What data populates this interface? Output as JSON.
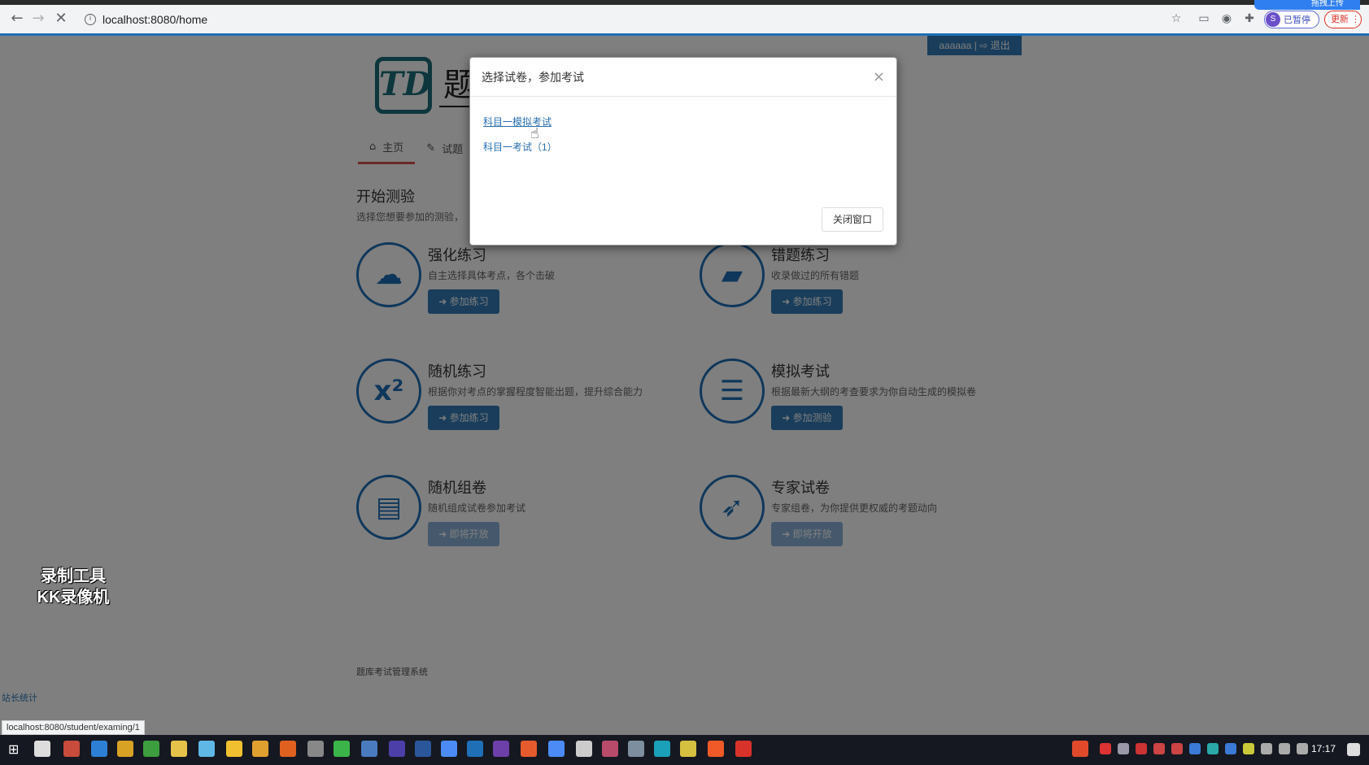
{
  "browser": {
    "url": "localhost:8080/home",
    "profile_initial": "S",
    "profile_status": "已暂停",
    "update_label": "更新",
    "upload_badge": "拖拽上传"
  },
  "header": {
    "user_link": "aaaaaa | ⇨ 退出",
    "logo_glyph": "TD",
    "logo_text": "题",
    "tabs": [
      {
        "label": "主页",
        "icon": "home-icon",
        "glyph": "⌂"
      },
      {
        "label": "试题",
        "icon": "edit-icon",
        "glyph": "✎"
      }
    ]
  },
  "main": {
    "section_title": "开始测验",
    "section_subtitle": "选择您想要参加的测验，",
    "cards": [
      {
        "title": "强化练习",
        "desc": "自主选择具体考点，各个击破",
        "button": "➜ 参加练习",
        "icon": "cloud-upload-icon",
        "glyph": "☁",
        "disabled": false
      },
      {
        "title": "错题练习",
        "desc": "收录做过的所有错题",
        "button": "➜ 参加练习",
        "icon": "eraser-icon",
        "glyph": "▰",
        "disabled": false
      },
      {
        "title": "随机练习",
        "desc": "根据你对考点的掌握程度智能出题，提升综合能力",
        "button": "➜ 参加练习",
        "icon": "superscript-icon",
        "glyph": "x²",
        "disabled": false
      },
      {
        "title": "模拟考试",
        "desc": "根据最新大纲的考查要求为你自动生成的模拟卷",
        "button": "➜ 参加测验",
        "icon": "document-icon",
        "glyph": "☰",
        "disabled": false
      },
      {
        "title": "随机组卷",
        "desc": "随机组成试卷参加考试",
        "button": "➜ 即将开放",
        "icon": "book-icon",
        "glyph": "▤",
        "disabled": true
      },
      {
        "title": "专家试卷",
        "desc": "专家组卷，为你提供更权威的考题动向",
        "button": "➜ 即将开放",
        "icon": "rocket-icon",
        "glyph": "➶",
        "disabled": true
      }
    ],
    "footer": "题库考试管理系统",
    "stats_link": "站长统计",
    "status_url": "localhost:8080/student/examing/1"
  },
  "modal": {
    "title": "选择试卷，参加考试",
    "close_glyph": "×",
    "exams": [
      "科目一模拟考试",
      "科目一考试（1）"
    ],
    "close_button": "关闭窗口"
  },
  "watermark": {
    "line1": "录制工具",
    "line2": "KK录像机"
  },
  "taskbar": {
    "clock": "17:17"
  }
}
